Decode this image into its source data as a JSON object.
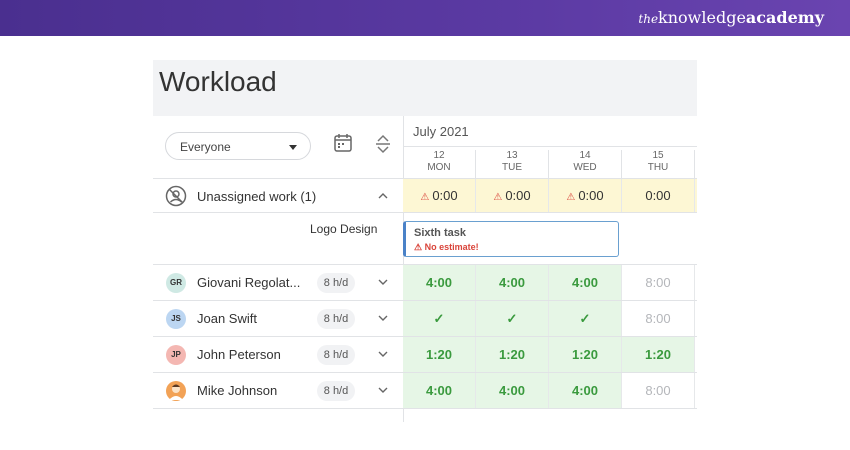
{
  "brand": {
    "the": "the",
    "knowledge": "knowledge",
    "academy": "academy"
  },
  "page": {
    "title": "Workload"
  },
  "filter": {
    "selected": "Everyone"
  },
  "calendar": {
    "month": "July 2021",
    "days": [
      {
        "num": "12",
        "name": "MON"
      },
      {
        "num": "13",
        "name": "TUE"
      },
      {
        "num": "14",
        "name": "WED"
      },
      {
        "num": "15",
        "name": "THU"
      }
    ]
  },
  "unassigned": {
    "label": "Unassigned work (1)",
    "cells": [
      "0:00",
      "0:00",
      "0:00",
      "0:00"
    ]
  },
  "logo_task": {
    "label": "Logo Design",
    "card_title": "Sixth task",
    "card_warning": "No estimate!"
  },
  "people": [
    {
      "initials": "GR",
      "name": "Giovani Regolat...",
      "hpd": "8 h/d",
      "avatar_color": "#cfe9e4",
      "cells": [
        "4:00",
        "4:00",
        "4:00",
        "8:00"
      ],
      "styles": [
        "green",
        "green",
        "green",
        "grey"
      ]
    },
    {
      "initials": "JS",
      "name": "Joan Swift",
      "hpd": "8 h/d",
      "avatar_color": "#bcd6f2",
      "cells": [
        "✓",
        "✓",
        "✓",
        "8:00"
      ],
      "styles": [
        "green",
        "green",
        "green",
        "grey"
      ]
    },
    {
      "initials": "JP",
      "name": "John Peterson",
      "hpd": "8 h/d",
      "avatar_color": "#f4b7b2",
      "cells": [
        "1:20",
        "1:20",
        "1:20",
        "1:20"
      ],
      "styles": [
        "green",
        "green",
        "green",
        "green"
      ]
    },
    {
      "initials": "",
      "name": "Mike Johnson",
      "hpd": "8 h/d",
      "avatar_color": "#f2a256",
      "cells": [
        "4:00",
        "4:00",
        "4:00",
        "8:00"
      ],
      "styles": [
        "green",
        "green",
        "green",
        "grey"
      ]
    }
  ],
  "colors": {
    "accent_green": "#3a9a3e",
    "warning_red": "#d9443a",
    "task_blue": "#4a82c8"
  }
}
